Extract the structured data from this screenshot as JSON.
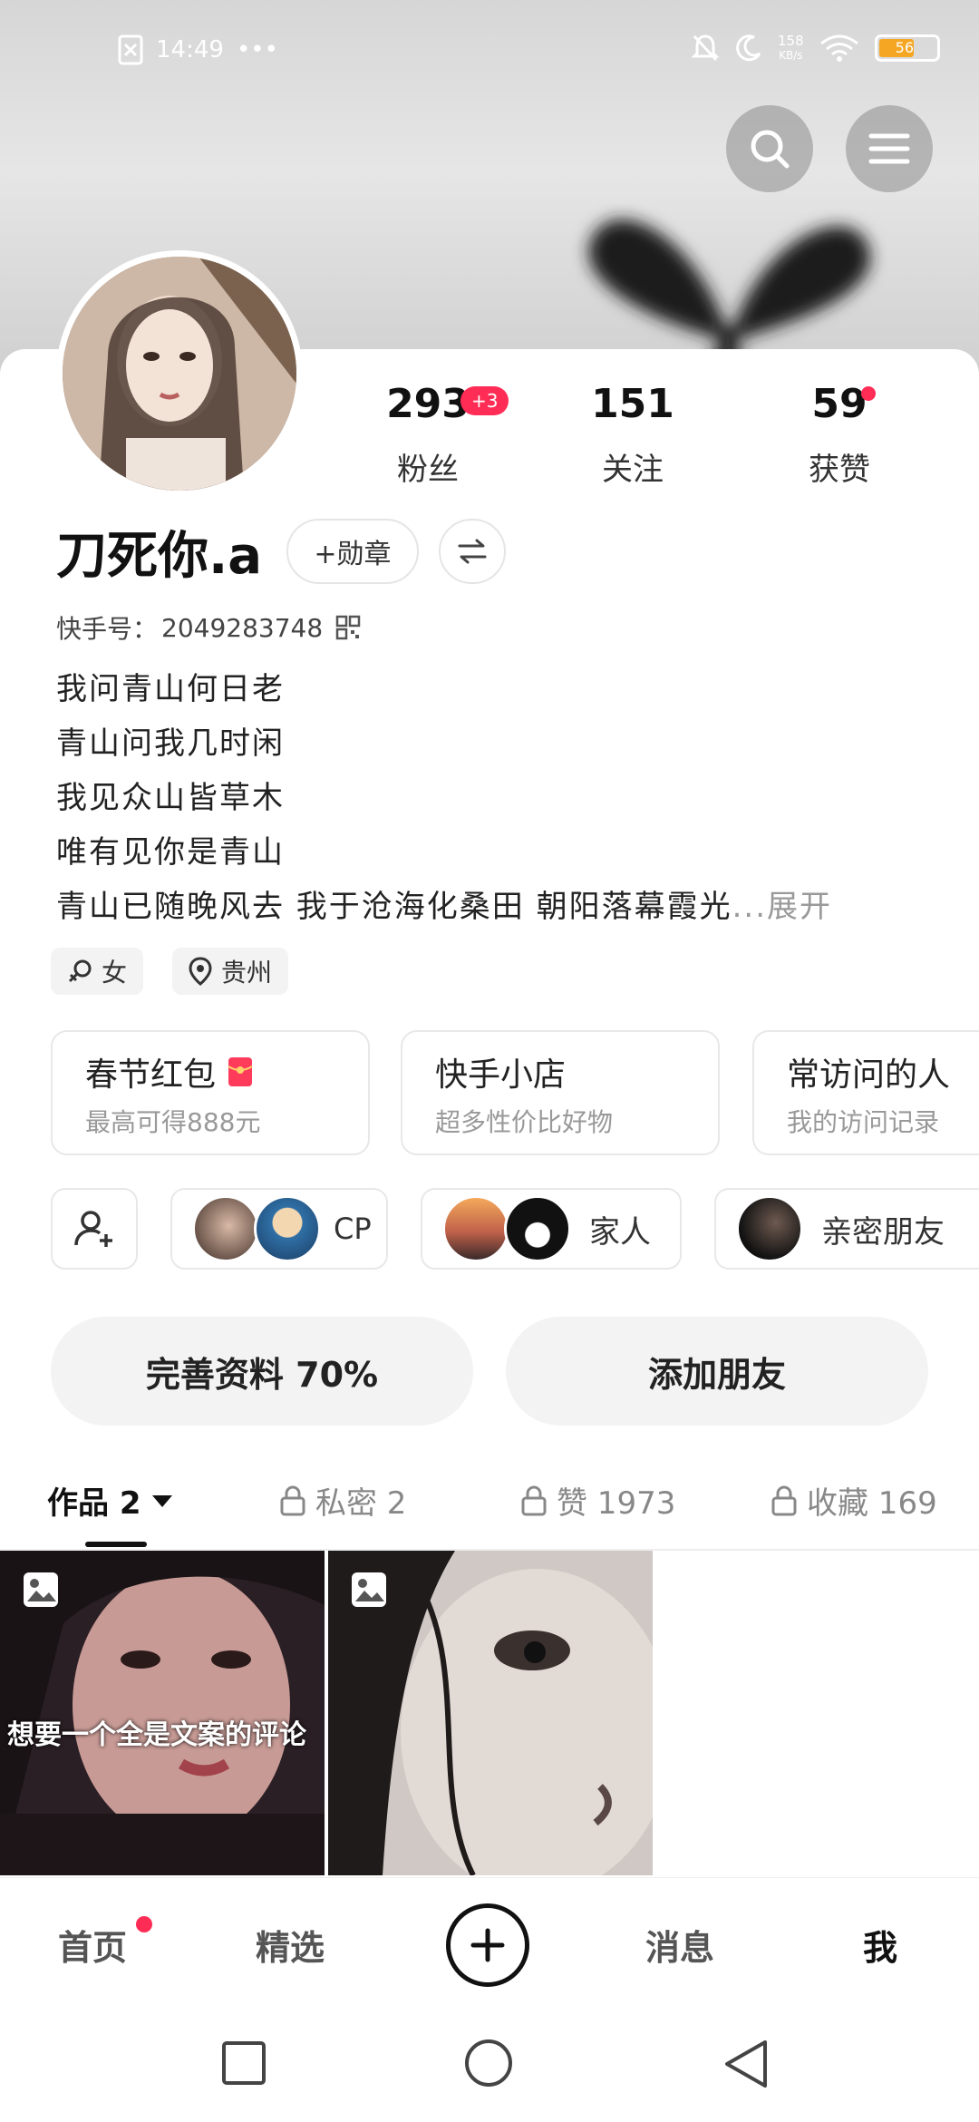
{
  "status_bar": {
    "time": "14:49",
    "more": "•••",
    "net_speed_value": "158",
    "net_speed_unit": "KB/s",
    "battery": "56"
  },
  "profile": {
    "name": "刀死你.a",
    "add_badge_label": "+勋章",
    "kuaishou_id_label": "快手号：",
    "kuaishou_id": "2049283748"
  },
  "stats": {
    "fans": {
      "value": "293",
      "label": "粉丝",
      "badge": "+3"
    },
    "following": {
      "value": "151",
      "label": "关注"
    },
    "likes": {
      "value": "59",
      "label": "获赞"
    }
  },
  "bio": {
    "lines": [
      "我问青山何日老",
      "青山问我几时闲",
      "我见众山皆草木",
      "唯有见你是青山",
      "青山已随晚风去 我于沧海化桑田 朝阳落幕霞光"
    ],
    "expand_label": "...展开"
  },
  "tags": {
    "gender": "女",
    "location": "贵州"
  },
  "cards": [
    {
      "title": "春节红包",
      "subtitle": "最高可得888元"
    },
    {
      "title": "快手小店",
      "subtitle": "超多性价比好物"
    },
    {
      "title": "常访问的人",
      "subtitle": "我的访问记录"
    }
  ],
  "relations": [
    {
      "label": "CP"
    },
    {
      "label": "家人"
    },
    {
      "label": "亲密朋友"
    }
  ],
  "actions": {
    "complete_profile": "完善资料 70%",
    "add_friend": "添加朋友"
  },
  "tabs": [
    {
      "label": "作品 2"
    },
    {
      "label": "私密 2"
    },
    {
      "label": "赞 1973"
    },
    {
      "label": "收藏 169"
    }
  ],
  "posts": [
    {
      "caption": "想要一个全是文案的评论"
    },
    {
      "caption": ""
    }
  ],
  "bottom_nav": {
    "home": "首页",
    "featured": "精选",
    "messages": "消息",
    "me": "我"
  },
  "colors": {
    "accent": "#ff2d55",
    "badge_text": "#ffffff"
  }
}
